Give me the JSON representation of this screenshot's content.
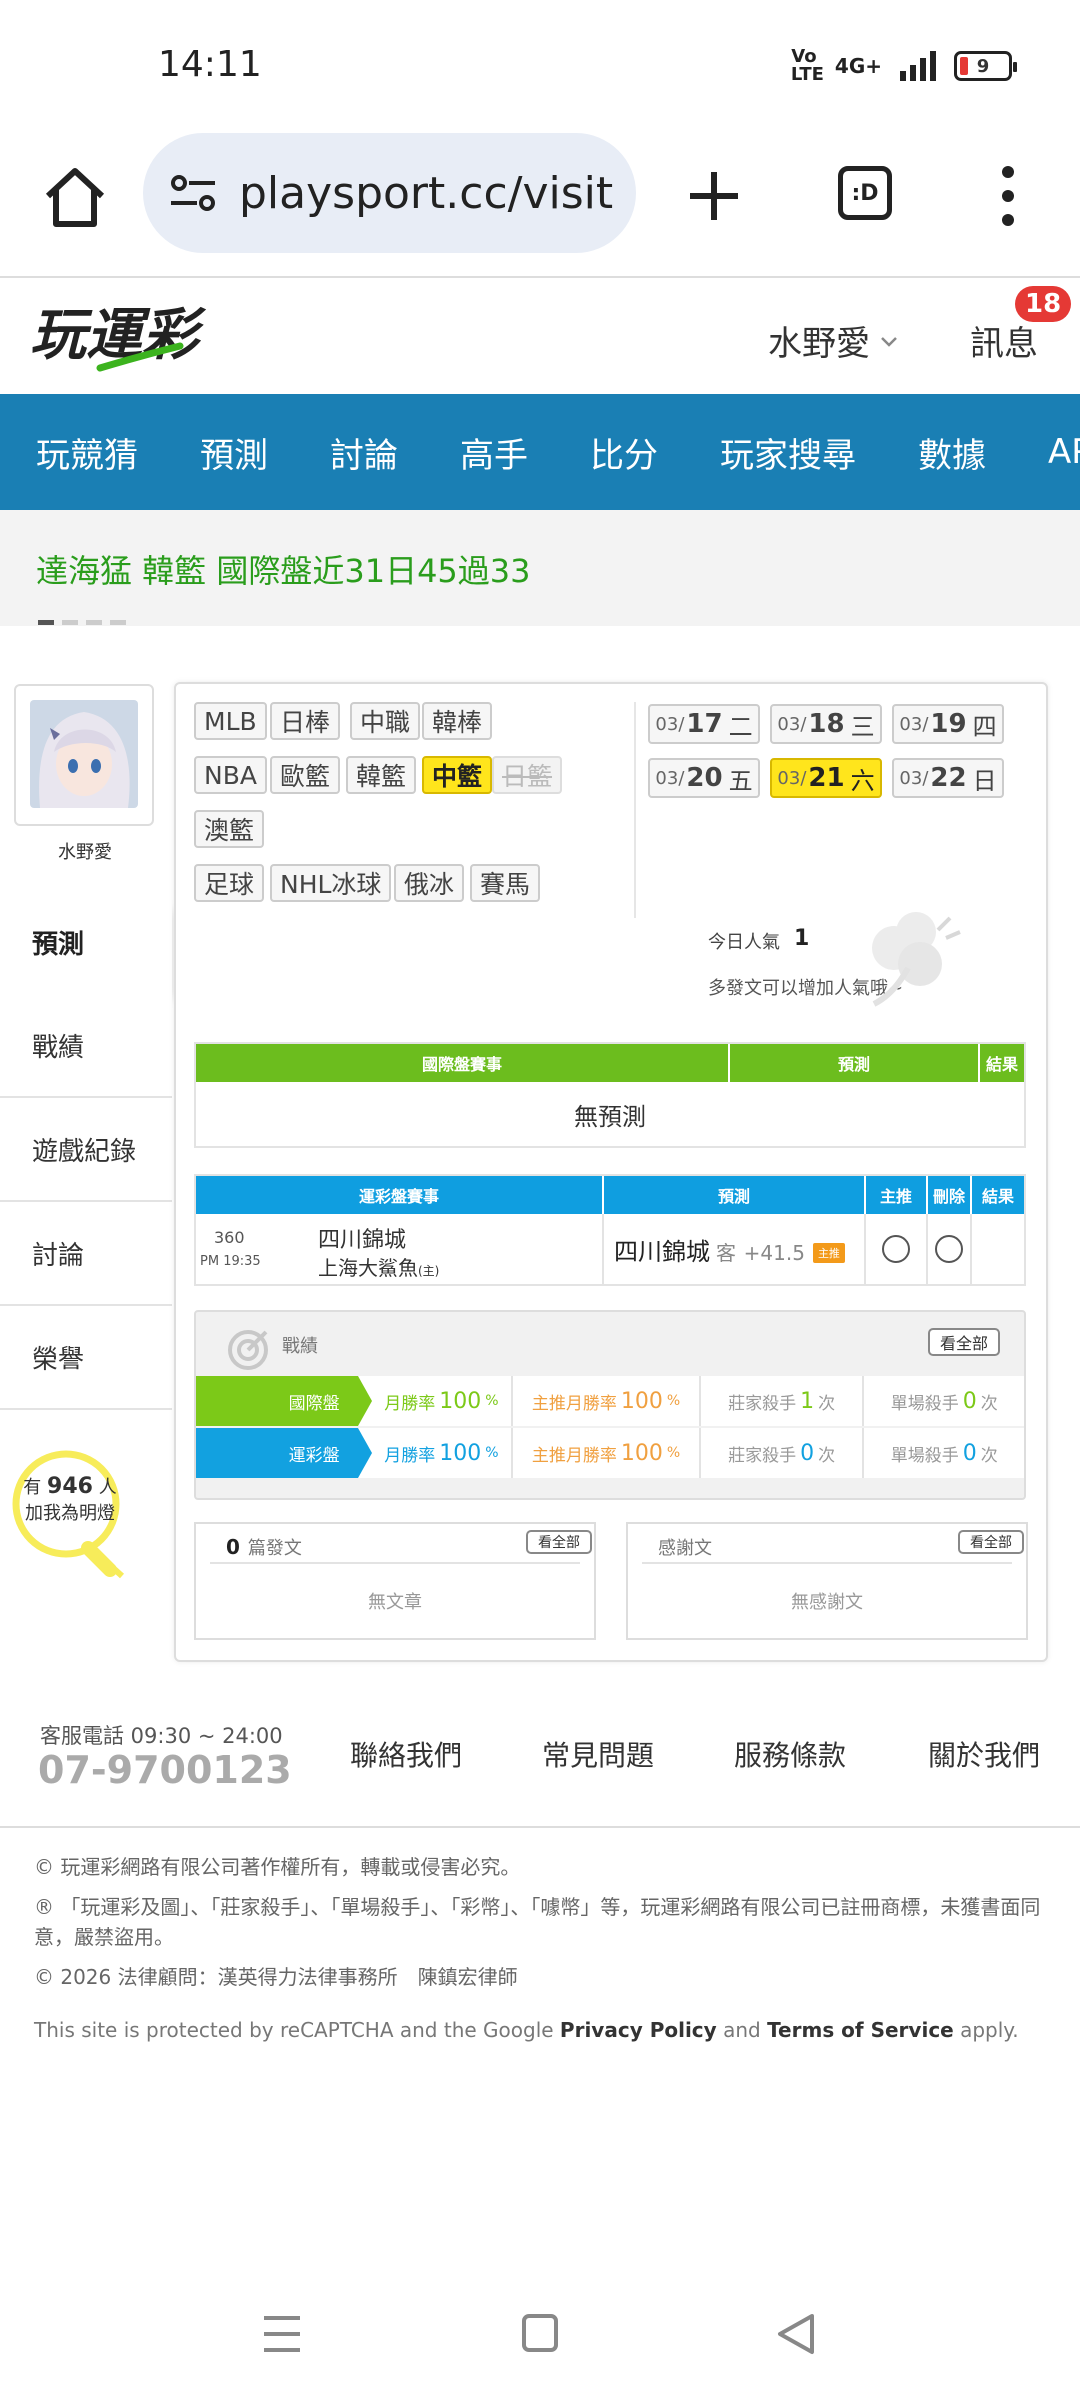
{
  "status_bar": {
    "time": "14:11",
    "network": "4G+",
    "volte": "Vo LTE",
    "battery": "9"
  },
  "browser": {
    "url": "playsport.cc/visit",
    "tabs_label": ":D"
  },
  "header": {
    "logo_text": "玩運彩",
    "username": "水野愛",
    "messages_label": "訊息",
    "messages_count": "18"
  },
  "nav": [
    "玩競猜",
    "預測",
    "討論",
    "高手",
    "比分",
    "玩家搜尋",
    "數據",
    "APP"
  ],
  "ticker": {
    "text": "達海猛 韓籃 國際盤近31日45過33"
  },
  "profile": {
    "name": "水野愛",
    "followers_prefix": "有",
    "followers_count": "946",
    "followers_suffix": "人",
    "follow_cta": "加我為明燈"
  },
  "side_menu": [
    "預測",
    "戰績",
    "遊戲紀錄",
    "討論",
    "榮譽"
  ],
  "sports": [
    "MLB",
    "日棒",
    "中職",
    "韓棒",
    "NBA",
    "歐籃",
    "韓籃",
    "中籃",
    "日籃",
    "澳籃",
    "足球",
    "NHL冰球",
    "俄冰",
    "賽馬"
  ],
  "sports_active": "中籃",
  "sports_disabled": "日籃",
  "dates": [
    {
      "m": "03/",
      "d": "17",
      "w": "二"
    },
    {
      "m": "03/",
      "d": "18",
      "w": "三"
    },
    {
      "m": "03/",
      "d": "19",
      "w": "四"
    },
    {
      "m": "03/",
      "d": "20",
      "w": "五"
    },
    {
      "m": "03/",
      "d": "21",
      "w": "六"
    },
    {
      "m": "03/",
      "d": "22",
      "w": "日"
    }
  ],
  "dates_active": "21",
  "popularity": {
    "label": "今日人氣",
    "value": "1",
    "hint": "多發文可以增加人氣哦~"
  },
  "intl_table": {
    "col_game": "國際盤賽事",
    "col_pick": "預測",
    "col_result": "結果",
    "empty": "無預測"
  },
  "lottery_table": {
    "col_game": "運彩盤賽事",
    "col_pick": "預測",
    "col_main": "主推",
    "col_delete": "刪除",
    "col_result": "結果",
    "rows": [
      {
        "id": "360",
        "time": "PM 19:35",
        "away": "四川錦城",
        "home": "上海大鯊魚",
        "home_mark": "(主)",
        "pick_team": "四川錦城",
        "pick_side": "客",
        "pick_line": "+41.5",
        "pick_tag": "主推"
      }
    ]
  },
  "record": {
    "title": "戰績",
    "view_all": "看全部",
    "rows": [
      {
        "label": "國際盤",
        "monthly_label": "月勝率",
        "monthly": "100",
        "main_label": "主推月勝率",
        "main": "100",
        "pct": "%",
        "dealer_label": "莊家殺手",
        "dealer": "1",
        "single_label": "單場殺手",
        "single": "0",
        "unit": "次"
      },
      {
        "label": "運彩盤",
        "monthly_label": "月勝率",
        "monthly": "100",
        "main_label": "主推月勝率",
        "main": "100",
        "pct": "%",
        "dealer_label": "莊家殺手",
        "dealer": "0",
        "single_label": "單場殺手",
        "single": "0",
        "unit": "次"
      }
    ]
  },
  "articles": {
    "posts_count": "0",
    "posts_label": "篇發文",
    "view_all": "看全部",
    "posts_empty": "無文章",
    "thanks_label": "感謝文",
    "thanks_empty": "無感謝文"
  },
  "footer": {
    "hotline_label": "客服電話 09:30 ~ 24:00",
    "hotline": "07-9700123",
    "links": [
      "聯絡我們",
      "常見問題",
      "服務條款",
      "關於我們"
    ],
    "copyright": "© 玩運彩網路有限公司著作權所有，轉載或侵害必究。",
    "trademark": "® 「玩運彩及圖」、「莊家殺手」、「單場殺手」、「彩幣」、「噱幣」等，玩運彩網路有限公司已註冊商標，未獲書面同意，嚴禁盜用。",
    "legal": "© 2026 法律顧問：漢英得力法律事務所　陳鎮宏律師",
    "recaptcha_pre": "This site is protected by reCAPTCHA and the Google",
    "privacy": "Privacy Policy",
    "and": "and",
    "terms": "Terms of Service",
    "apply": "apply."
  },
  "colors": {
    "nav_blue": "#1a7fb4",
    "intl_green": "#6cbd1e",
    "lottery_blue": "#0f9ee0",
    "highlight_yellow": "#ffe51c",
    "ticker_green": "#2a9d1c"
  }
}
